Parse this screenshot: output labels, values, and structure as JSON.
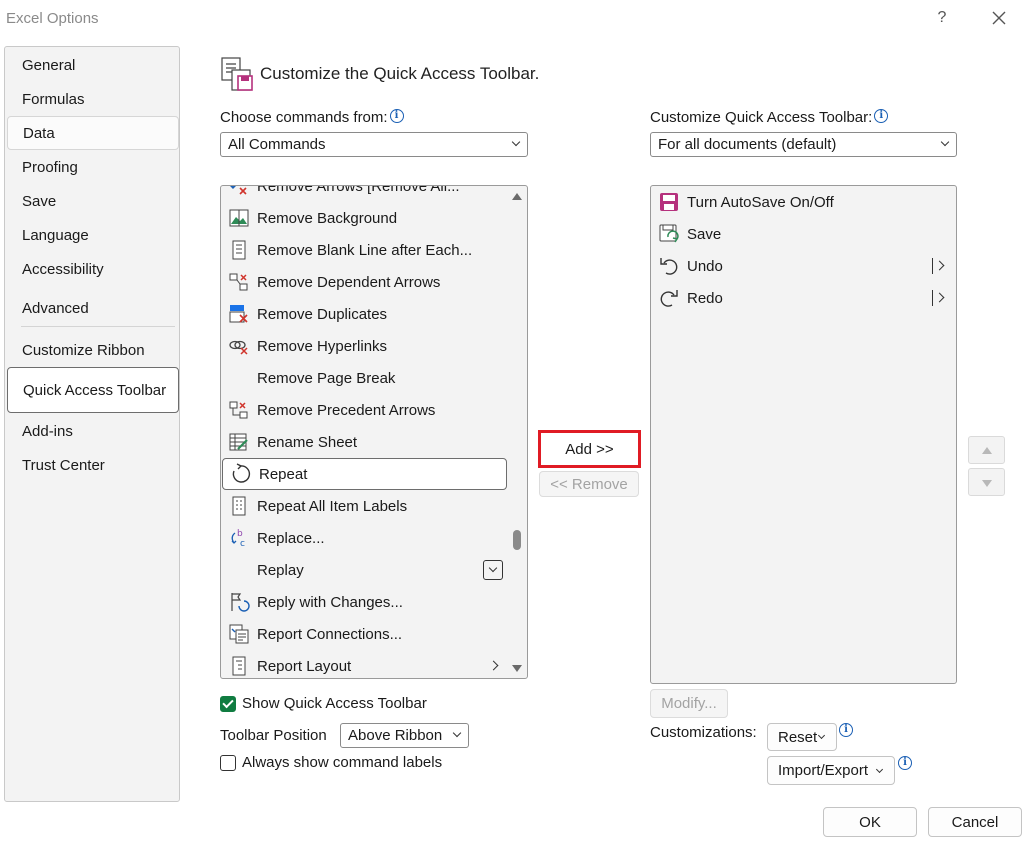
{
  "window": {
    "title": "Excel Options",
    "help_label": "?",
    "close_label": "✕"
  },
  "nav": {
    "items": [
      {
        "label": "General"
      },
      {
        "label": "Formulas"
      },
      {
        "label": "Data"
      },
      {
        "label": "Proofing"
      },
      {
        "label": "Save"
      },
      {
        "label": "Language"
      },
      {
        "label": "Accessibility"
      },
      {
        "label": "Advanced"
      },
      {
        "label": "Customize Ribbon"
      },
      {
        "label": "Quick Access Toolbar"
      },
      {
        "label": "Add-ins"
      },
      {
        "label": "Trust Center"
      }
    ],
    "selected": "Quick Access Toolbar",
    "hovered": "Data"
  },
  "main": {
    "heading": "Customize the Quick Access Toolbar.",
    "choose_label": "Choose commands from:",
    "choose_value": "All Commands",
    "customize_label": "Customize Quick Access Toolbar:",
    "customize_value": "For all documents (default)",
    "commands": [
      {
        "label": "Remove Arrows [Remove All...",
        "icon": "remove-arrows-icon"
      },
      {
        "label": "Remove Background",
        "icon": "remove-background-icon"
      },
      {
        "label": "Remove Blank Line after Each...",
        "icon": "remove-blank-line-icon"
      },
      {
        "label": "Remove Dependent Arrows",
        "icon": "remove-dependent-arrows-icon"
      },
      {
        "label": "Remove Duplicates",
        "icon": "remove-duplicates-icon"
      },
      {
        "label": "Remove Hyperlinks",
        "icon": "remove-hyperlinks-icon"
      },
      {
        "label": "Remove Page Break",
        "icon": ""
      },
      {
        "label": "Remove Precedent Arrows",
        "icon": "remove-precedent-arrows-icon"
      },
      {
        "label": "Rename Sheet",
        "icon": "rename-sheet-icon"
      },
      {
        "label": "Repeat",
        "icon": "repeat-icon",
        "selected": true
      },
      {
        "label": "Repeat All Item Labels",
        "icon": "repeat-all-item-labels-icon"
      },
      {
        "label": "Replace...",
        "icon": "replace-icon"
      },
      {
        "label": "Replay",
        "icon": "",
        "dropdown": true
      },
      {
        "label": "Reply with Changes...",
        "icon": "reply-with-changes-icon"
      },
      {
        "label": "Report Connections...",
        "icon": "report-connections-icon"
      },
      {
        "label": "Report Layout",
        "icon": "report-layout-icon",
        "submenu": true
      }
    ],
    "add_label": "Add >>",
    "remove_label": "<< Remove",
    "toolbar_items": [
      {
        "label": "Turn AutoSave On/Off",
        "icon": "autosave-icon"
      },
      {
        "label": "Save",
        "icon": "save-icon"
      },
      {
        "label": "Undo",
        "icon": "undo-icon",
        "split": true
      },
      {
        "label": "Redo",
        "icon": "redo-icon",
        "split": true
      }
    ],
    "modify_label": "Modify...",
    "show_qat_label": "Show Quick Access Toolbar",
    "show_qat_checked": true,
    "toolbar_position_label": "Toolbar Position",
    "toolbar_position_value": "Above Ribbon",
    "always_show_labels_label": "Always show command labels",
    "always_show_labels_checked": false,
    "customizations_label": "Customizations:",
    "reset_label": "Reset",
    "import_export_label": "Import/Export"
  },
  "footer": {
    "ok_label": "OK",
    "cancel_label": "Cancel"
  },
  "colors": {
    "highlight": "#e01b24",
    "check": "#107c41",
    "info": "#1a5fb4"
  }
}
